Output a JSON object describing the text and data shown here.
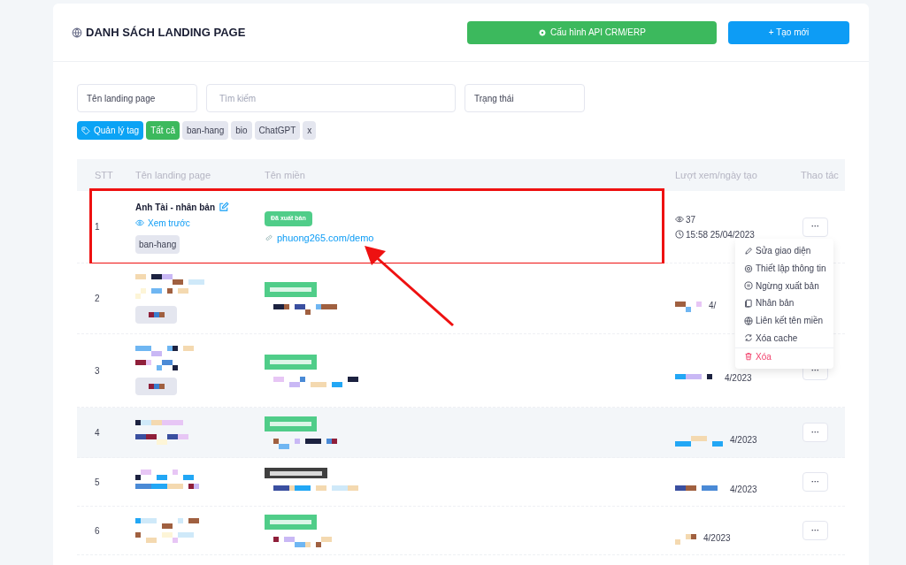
{
  "header": {
    "title": "DANH SÁCH LANDING PAGE",
    "buttons": [
      {
        "kind": "config",
        "label": "Cấu hình API CRM/ERP"
      },
      {
        "kind": "create",
        "label": "+ Tạo mới"
      }
    ]
  },
  "filters": [
    {
      "kind": "select",
      "value": "Tên landing page"
    },
    {
      "kind": "text",
      "placeholder": "Tìm kiếm"
    },
    {
      "kind": "select",
      "value": "Trạng thái"
    }
  ],
  "manage_tags": {
    "label": "Quản lý tag"
  },
  "tags": [
    {
      "label": "Tất cả",
      "selected": true
    },
    {
      "label": "ban-hang",
      "selected": false
    },
    {
      "label": "bio",
      "selected": false
    },
    {
      "label": "ChatGPT",
      "selected": false
    },
    {
      "label": "x",
      "selected": false
    }
  ],
  "table": {
    "columns": [
      "STT",
      "Tên landing page",
      "Tên miền",
      "Lượt xem/ngày tạo",
      "Thao tác"
    ],
    "rows": [
      {
        "kind": "visible",
        "stt": "1",
        "name": "Anh Tài - nhân bản",
        "preview": "Xem trước",
        "tag": "ban-hang",
        "status": "Đã xuất bản",
        "domain": "phuong265.com/demo",
        "views": "37",
        "created": "15:58 25/04/2023",
        "more": "···",
        "annotated": true,
        "highlighted": false,
        "menu_open": true
      },
      {
        "kind": "hidden",
        "stt": "2",
        "created": "4/",
        "has_tag": true,
        "dark_badge": false,
        "highlighted": false
      },
      {
        "kind": "hidden",
        "stt": "3",
        "created": "4/2023",
        "more": "···",
        "has_tag": true,
        "dark_badge": false,
        "highlighted": false
      },
      {
        "kind": "hidden",
        "stt": "4",
        "created": "4/2023",
        "more": "···",
        "has_tag": false,
        "dark_badge": false,
        "highlighted": true
      },
      {
        "kind": "hidden",
        "stt": "5",
        "created": "4/2023",
        "more": "···",
        "has_tag": false,
        "dark_badge": true,
        "highlighted": false
      },
      {
        "kind": "hidden",
        "stt": "6",
        "created": "4/2023",
        "more": "···",
        "has_tag": false,
        "dark_badge": false,
        "highlighted": false
      }
    ]
  },
  "action_menu": [
    {
      "kind": "edit",
      "label": "Sửa giao diện"
    },
    {
      "kind": "settings",
      "label": "Thiết lập thông tin"
    },
    {
      "kind": "pause",
      "label": "Ngừng xuất bản"
    },
    {
      "kind": "copy",
      "label": "Nhân bản"
    },
    {
      "kind": "globe",
      "label": "Liên kết tên miền"
    },
    {
      "kind": "refresh",
      "label": "Xóa cache"
    },
    {
      "kind": "delete",
      "label": "Xóa"
    }
  ]
}
